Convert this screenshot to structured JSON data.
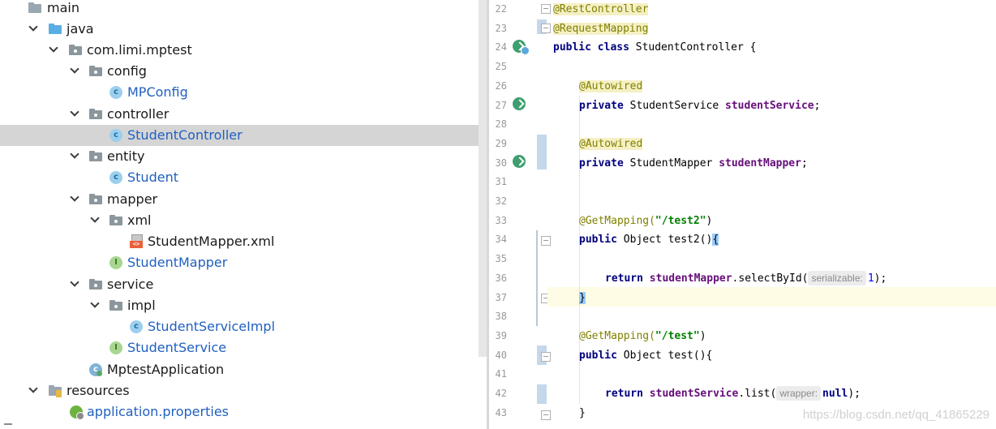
{
  "project_tree": {
    "items": [
      {
        "label": "main",
        "icon": "folder-icon"
      },
      {
        "label": "java",
        "icon": "source-folder-icon"
      },
      {
        "label": "com.limi.mptest",
        "icon": "package-icon"
      },
      {
        "label": "config",
        "icon": "package-icon"
      },
      {
        "label": "MPConfig",
        "icon": "class-icon"
      },
      {
        "label": "controller",
        "icon": "package-icon"
      },
      {
        "label": "StudentController",
        "icon": "class-icon",
        "selected": true
      },
      {
        "label": "entity",
        "icon": "package-icon"
      },
      {
        "label": "Student",
        "icon": "class-icon"
      },
      {
        "label": "mapper",
        "icon": "package-icon"
      },
      {
        "label": "xml",
        "icon": "package-icon"
      },
      {
        "label": "StudentMapper.xml",
        "icon": "xml-file-icon"
      },
      {
        "label": "StudentMapper",
        "icon": "interface-icon"
      },
      {
        "label": "service",
        "icon": "package-icon"
      },
      {
        "label": "impl",
        "icon": "package-icon"
      },
      {
        "label": "StudentServiceImpl",
        "icon": "class-icon"
      },
      {
        "label": "StudentService",
        "icon": "interface-icon"
      },
      {
        "label": "MptestApplication",
        "icon": "spring-app-class-icon"
      },
      {
        "label": "resources",
        "icon": "resources-folder-icon"
      },
      {
        "label": "application.properties",
        "icon": "spring-properties-icon"
      }
    ]
  },
  "editor": {
    "line_numbers": [
      "22",
      "23",
      "24",
      "25",
      "26",
      "27",
      "28",
      "29",
      "30",
      "31",
      "32",
      "33",
      "34",
      "35",
      "36",
      "37",
      "38",
      "39",
      "40",
      "41",
      "42",
      "43"
    ],
    "line22": {
      "ann": "@RestController"
    },
    "line23": {
      "ann": "@RequestMapping"
    },
    "line24": {
      "kw": "public class",
      "rest": " StudentController {"
    },
    "line26": {
      "ann": "@Autowired"
    },
    "line27": {
      "kw": "private",
      "type": " StudentService ",
      "field": "studentService",
      "end": ";"
    },
    "line29": {
      "ann": "@Autowired"
    },
    "line30": {
      "kw": "private",
      "type": " StudentMapper ",
      "field": "studentMapper",
      "end": ";"
    },
    "line33": {
      "ann": "@GetMapping(",
      "str": "\"/test2\"",
      "close": ")"
    },
    "line34": {
      "kw": "public",
      "rest": " Object test2()",
      "brace": "{"
    },
    "line36": {
      "kw": "return",
      "field": "studentMapper",
      "call": ".selectById(",
      "hint": "serializable:",
      "num": "1",
      "end": ");"
    },
    "line37": {
      "brace": "}"
    },
    "line39": {
      "ann": "@GetMapping(",
      "str": "\"/test\"",
      "close": ")"
    },
    "line40": {
      "kw": "public",
      "rest": " Object test(){"
    },
    "line42": {
      "kw": "return",
      "field": "studentService",
      "call": ".list(",
      "hint": "wrapper:",
      "val": "null",
      "end": ");"
    },
    "line43": {
      "brace": "}"
    }
  },
  "watermark": "https://blog.csdn.net/qq_41865229",
  "colors": {
    "selection": "#d5d5d5",
    "annotation": "#808000",
    "keyword": "#000080",
    "field": "#660e7a",
    "string": "#008000"
  }
}
